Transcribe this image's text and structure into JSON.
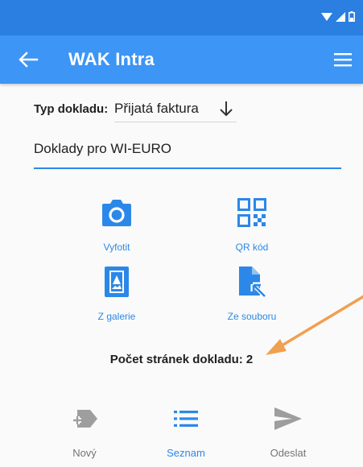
{
  "app": {
    "title": "WAK Intra"
  },
  "colors": {
    "primary": "#3d95f5",
    "status_bar": "#2a7fe0",
    "accent": "#2b88e8",
    "annotation": "#f0a050",
    "disabled": "#9e9e9e"
  },
  "status_icons": [
    "wifi-icon",
    "signal-icon",
    "battery-icon"
  ],
  "toolbar": {
    "back_icon": "arrow-left-icon",
    "menu_icon": "hamburger-menu-icon"
  },
  "doc_type": {
    "label": "Typ dokladu:",
    "value": "Přijatá faktura",
    "icon": "arrow-down-icon"
  },
  "doc_name": {
    "value": "Doklady pro WI-EURO"
  },
  "actions": [
    {
      "label": "Vyfotit",
      "icon": "camera-icon"
    },
    {
      "label": "QR kód",
      "icon": "qr-code-icon"
    },
    {
      "label": "Z galerie",
      "icon": "gallery-icon"
    },
    {
      "label": "Ze souboru",
      "icon": "file-icon"
    }
  ],
  "page_count": {
    "text": "Počet stránek dokladu: 2"
  },
  "bottom_nav": [
    {
      "label": "Nový",
      "icon": "new-document-icon",
      "state": "disabled"
    },
    {
      "label": "Seznam",
      "icon": "list-icon",
      "state": "active"
    },
    {
      "label": "Odeslat",
      "icon": "send-icon",
      "state": "disabled"
    }
  ]
}
